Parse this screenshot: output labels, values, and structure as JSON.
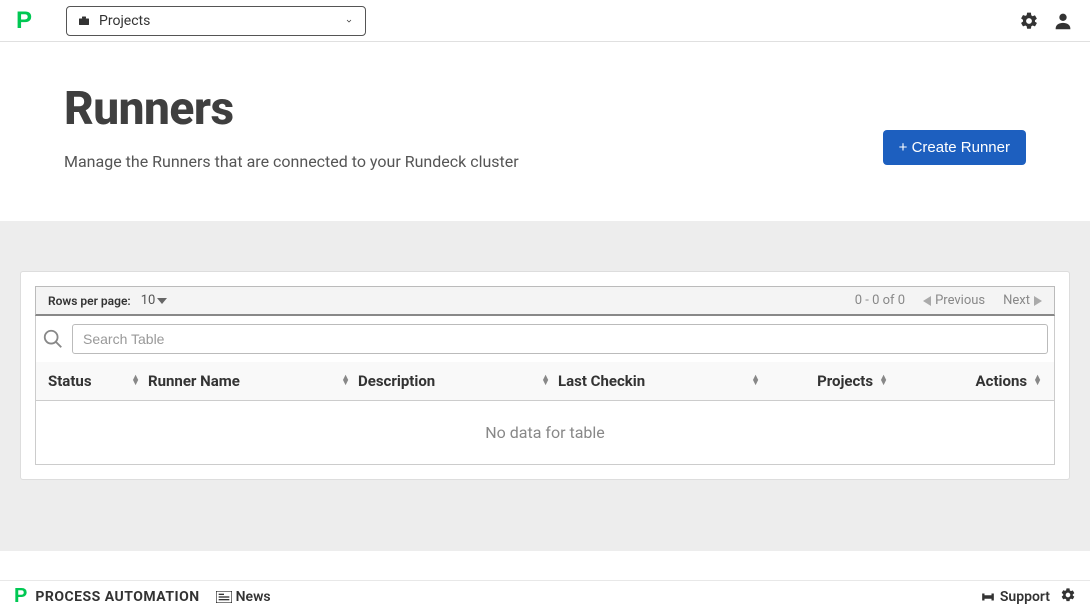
{
  "topbar": {
    "projects_label": "Projects"
  },
  "header": {
    "title": "Runners",
    "subtitle": "Manage the Runners that are connected to your Rundeck cluster",
    "create_button": "+ Create Runner"
  },
  "table": {
    "rows_per_page_label": "Rows per page:",
    "rows_per_page_value": "10",
    "range_text": "0 - 0 of 0",
    "previous_label": "Previous",
    "next_label": "Next",
    "search_placeholder": "Search Table",
    "columns": {
      "status": "Status",
      "runner_name": "Runner Name",
      "description": "Description",
      "last_checkin": "Last Checkin",
      "projects": "Projects",
      "actions": "Actions"
    },
    "empty_message": "No data for table"
  },
  "footer": {
    "brand": "PROCESS AUTOMATION",
    "news_label": "News",
    "support_label": "Support"
  }
}
